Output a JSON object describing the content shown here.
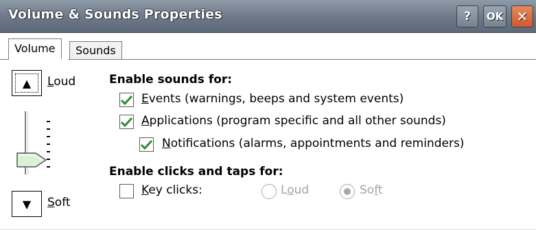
{
  "window": {
    "title": "Volume & Sounds Properties",
    "help_label": "?",
    "ok_label": "OK",
    "close_label": "✕"
  },
  "tabs": [
    {
      "label": "Volume",
      "selected": true
    },
    {
      "label": "Sounds",
      "selected": false
    }
  ],
  "volume_slider": {
    "up_glyph": "▲",
    "down_glyph": "▼",
    "loud_label": "Loud",
    "soft_label": "Soft",
    "level": 0.2
  },
  "enable_sounds": {
    "heading": "Enable sounds for:",
    "events": {
      "label": "Events (warnings, beeps and system events)",
      "checked": true
    },
    "applications": {
      "label": "Applications (program specific and all other sounds)",
      "checked": true
    },
    "notifications": {
      "label": "Notifications (alarms, appointments and reminders)",
      "checked": true
    }
  },
  "enable_clicks": {
    "heading": "Enable clicks and taps for:",
    "key_clicks": {
      "label": "Key clicks:",
      "checked": false
    },
    "loud_option": {
      "label": "Loud",
      "selected": false,
      "enabled": false
    },
    "soft_option": {
      "label": "Soft",
      "selected": true,
      "enabled": false
    }
  },
  "colors": {
    "titlebar": "#6c7888",
    "close_button": "#d2582c",
    "check_mark": "#2e8b2e",
    "disabled_text": "#a3a3a3"
  }
}
